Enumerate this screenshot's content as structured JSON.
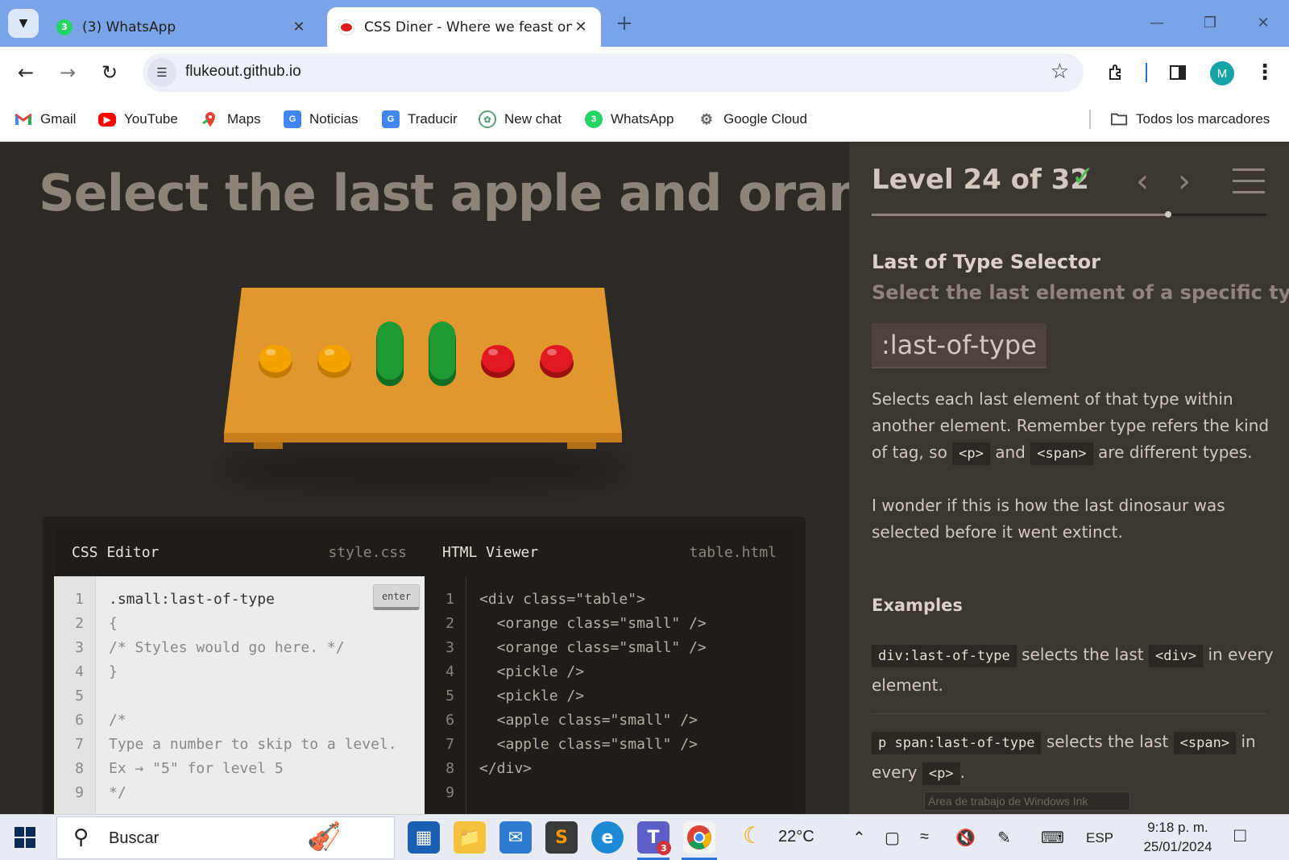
{
  "browser": {
    "tabs": [
      {
        "title": "(3) WhatsApp",
        "badge": "3",
        "active": false
      },
      {
        "title": "CSS Diner - Where we feast on CSS Selectors!",
        "active": true
      }
    ],
    "new_tab": "+",
    "url": "flukeout.github.io",
    "avatar_initial": "M",
    "bookmarks": [
      "Gmail",
      "YouTube",
      "Maps",
      "Noticias",
      "Traducir",
      "New chat",
      "WhatsApp",
      "Google Cloud"
    ],
    "whatsapp_badge": "3",
    "all_bookmarks": "Todos los marcadores"
  },
  "game": {
    "instruction": "Select the last apple and orange",
    "table_items": [
      {
        "kind": "orange",
        "color": "#f5a300"
      },
      {
        "kind": "orange",
        "color": "#f5a300"
      },
      {
        "kind": "pickle",
        "color": "#1f9a33"
      },
      {
        "kind": "pickle",
        "color": "#1f9a33"
      },
      {
        "kind": "apple",
        "color": "#e0181f"
      },
      {
        "kind": "apple",
        "color": "#e0181f"
      }
    ],
    "css_editor": {
      "title": "CSS Editor",
      "file": "style.css",
      "enter_label": "enter",
      "line_numbers": [
        "1",
        "2",
        "3",
        "4",
        "5",
        "6",
        "7",
        "8",
        "9"
      ],
      "lines": [
        ".small:last-of-type",
        "{",
        "/* Styles would go here. */",
        "}",
        "",
        "/*",
        "Type a number to skip to a level.",
        "Ex → \"5\" for level 5",
        "*/"
      ]
    },
    "html_viewer": {
      "title": "HTML Viewer",
      "file": "table.html",
      "line_numbers": [
        "1",
        "2",
        "3",
        "4",
        "5",
        "6",
        "7",
        "8",
        "9"
      ],
      "lines": [
        "<div class=\"table\">",
        "  <orange class=\"small\" />",
        "  <orange class=\"small\" />",
        "  <pickle />",
        "  <pickle />",
        "  <apple class=\"small\" />",
        "  <apple class=\"small\" />",
        "</div>",
        ""
      ]
    }
  },
  "sidebar": {
    "level_label": "Level 24 of 32",
    "completed_mark": "✓",
    "progress": 0.75,
    "prev": "‹",
    "next": "›",
    "selector_name": "Last of Type Selector",
    "selector_title": "Select the last element of a specific type",
    "syntax": ":last-of-type",
    "desc1_a": "Selects each last element of that type within another element. Remember type refers the kind of tag, so",
    "desc1_tag1": "<p>",
    "desc1_b": "and",
    "desc1_tag2": "<span>",
    "desc1_c": "are different types.",
    "desc2": "I wonder if this is how the last dinosaur was selected before it went extinct.",
    "examples_title": "Examples",
    "ex1_code": "div:last-of-type",
    "ex1_a": "selects the last",
    "ex1_tag": "<div>",
    "ex1_b": "in every element.",
    "ex2_code": "p span:last-of-type",
    "ex2_a": "selects the last",
    "ex2_tag": "<span>",
    "ex2_b": "in every",
    "ex2_tag2": "<p>",
    "ex2_end": ".",
    "ink_tooltip": "Área de trabajo de Windows Ink"
  },
  "taskbar": {
    "search_placeholder": "Buscar",
    "teams_badge": "3",
    "temperature": "22°C",
    "language": "ESP",
    "time": "9:18 p. m.",
    "date": "25/01/2024"
  }
}
